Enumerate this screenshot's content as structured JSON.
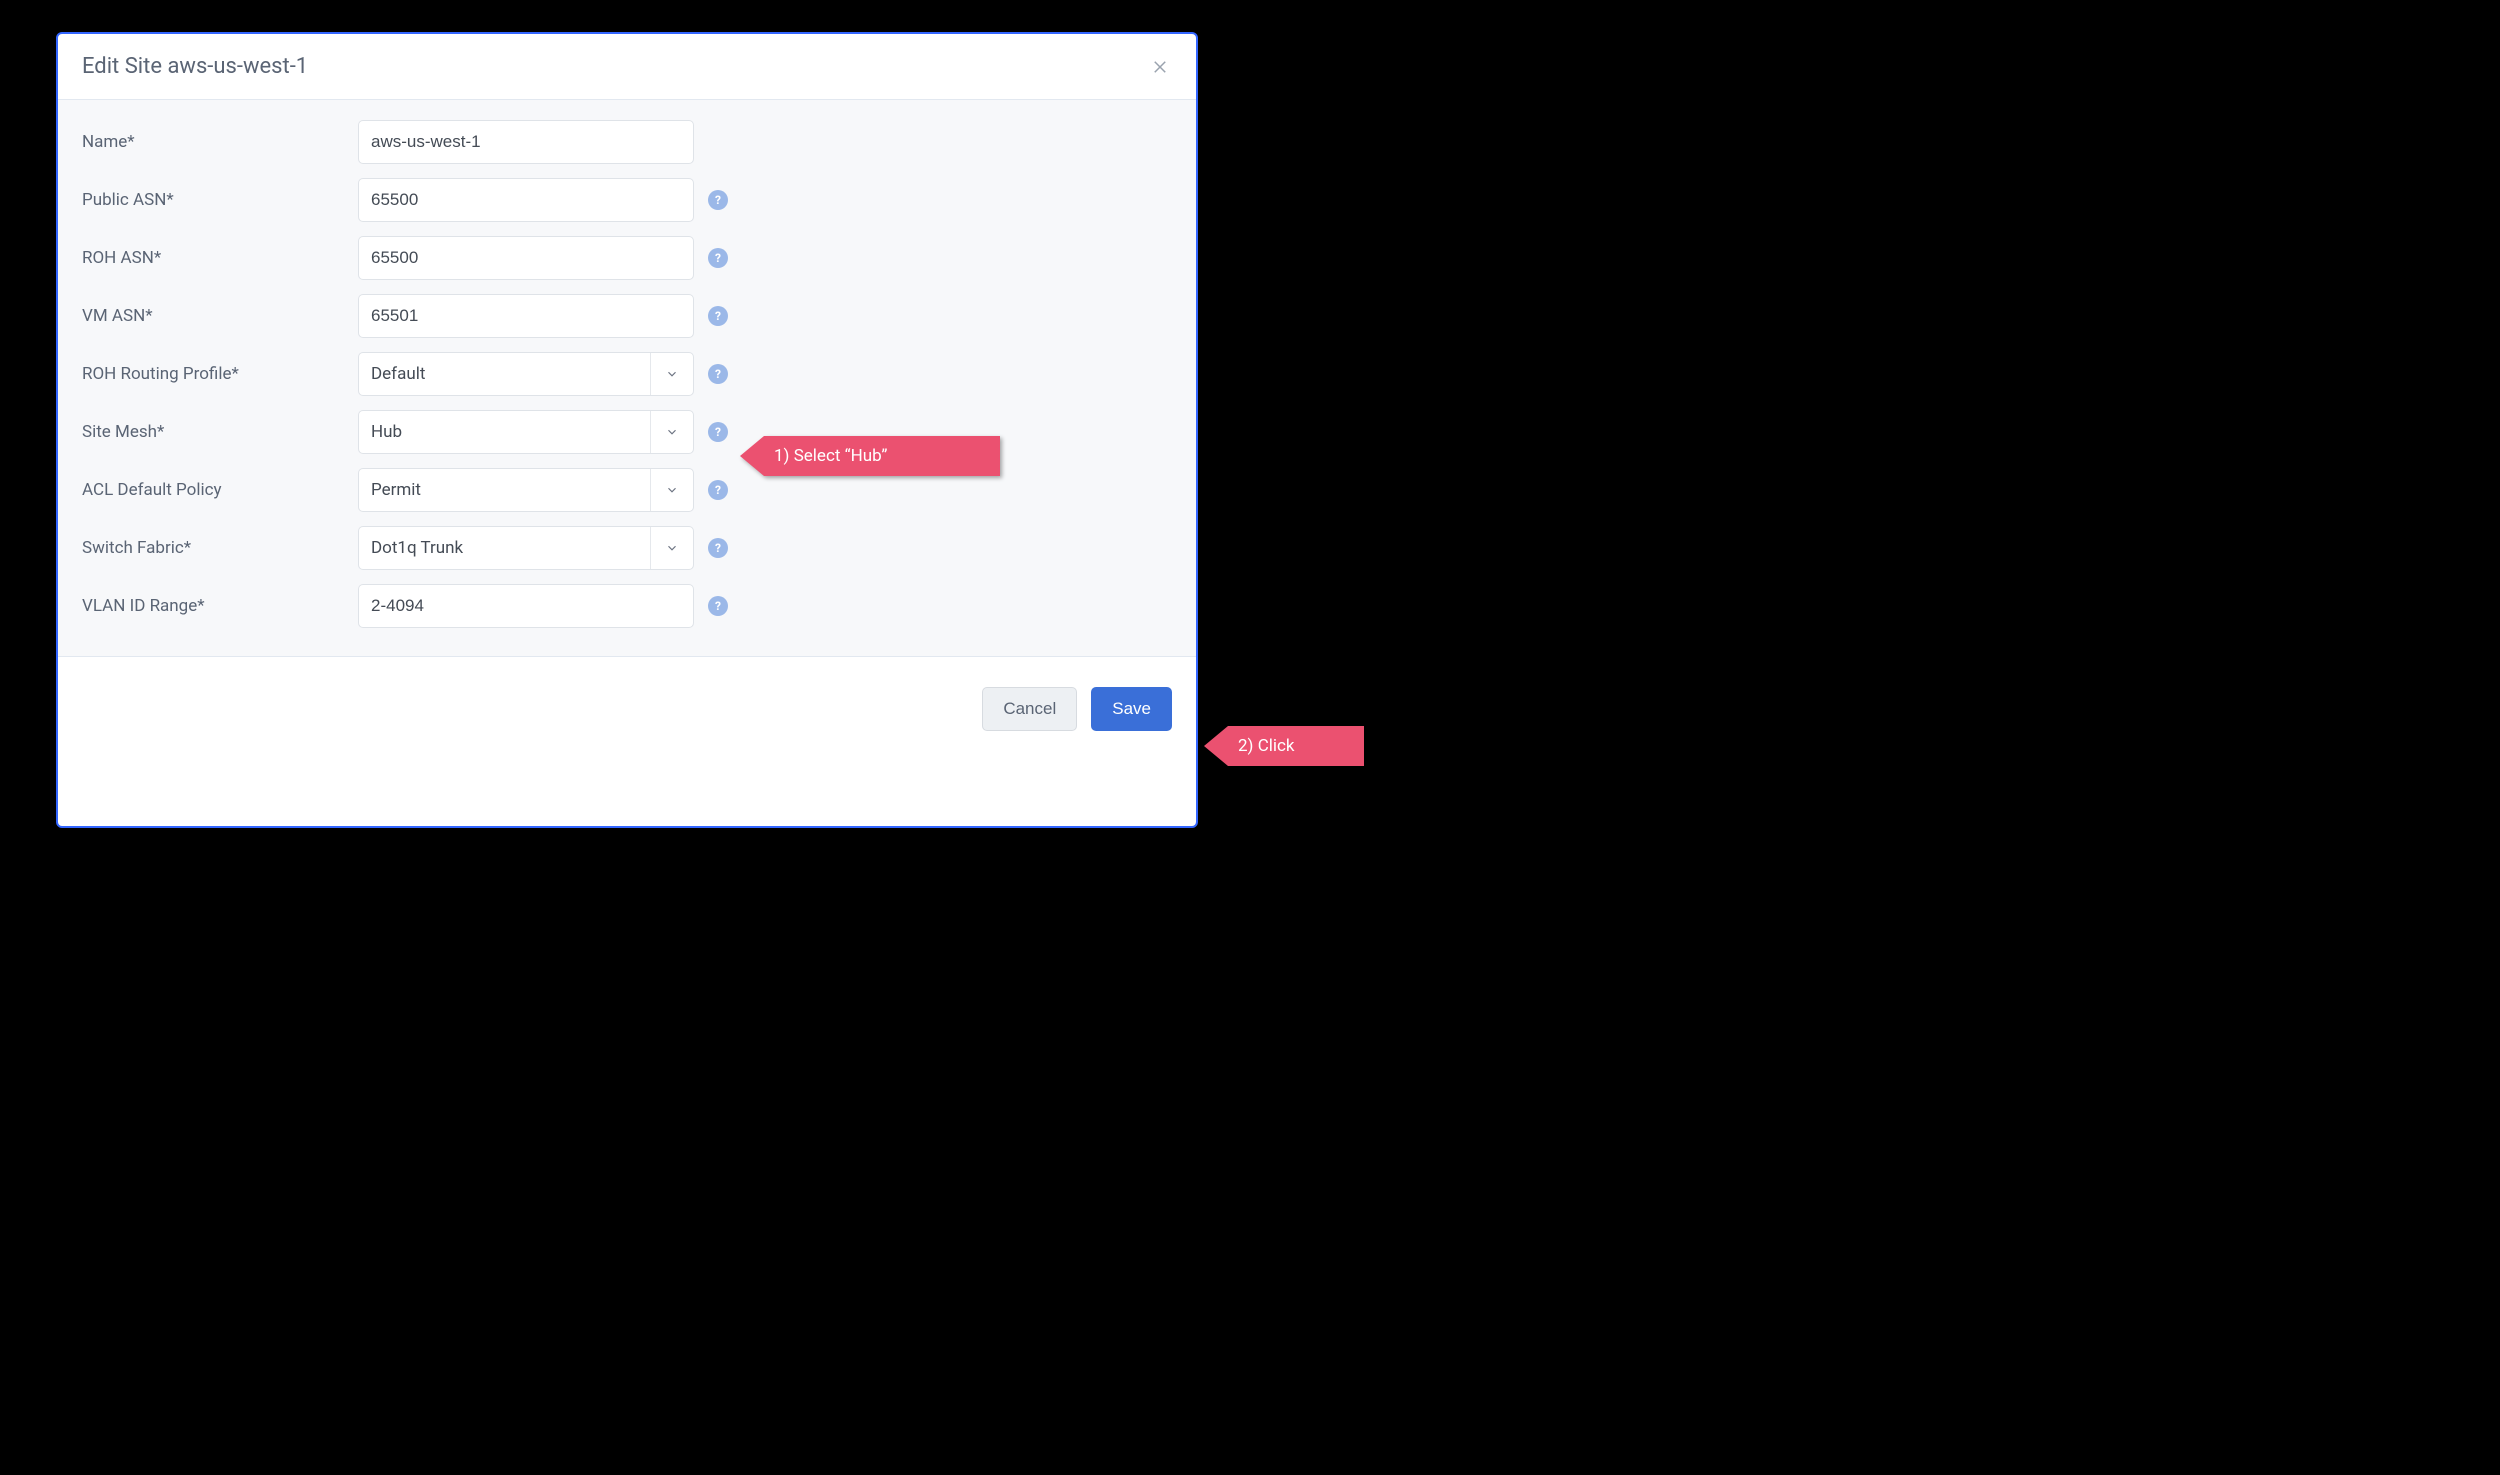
{
  "modal": {
    "title": "Edit Site aws-us-west-1"
  },
  "form": {
    "name": {
      "label": "Name*",
      "value": "aws-us-west-1"
    },
    "public_asn": {
      "label": "Public ASN*",
      "value": "65500"
    },
    "roh_asn": {
      "label": "ROH ASN*",
      "value": "65500"
    },
    "vm_asn": {
      "label": "VM ASN*",
      "value": "65501"
    },
    "roh_profile": {
      "label": "ROH Routing Profile*",
      "value": "Default"
    },
    "site_mesh": {
      "label": "Site Mesh*",
      "value": "Hub"
    },
    "acl_policy": {
      "label": "ACL Default Policy",
      "value": "Permit"
    },
    "switch_fabric": {
      "label": "Switch Fabric*",
      "value": "Dot1q Trunk"
    },
    "vlan_range": {
      "label": "VLAN ID Range*",
      "value": "2-4094"
    }
  },
  "help_glyph": "?",
  "footer": {
    "cancel": "Cancel",
    "save": "Save"
  },
  "annotations": {
    "one": "1) Select “Hub”",
    "two": "2) Click"
  }
}
